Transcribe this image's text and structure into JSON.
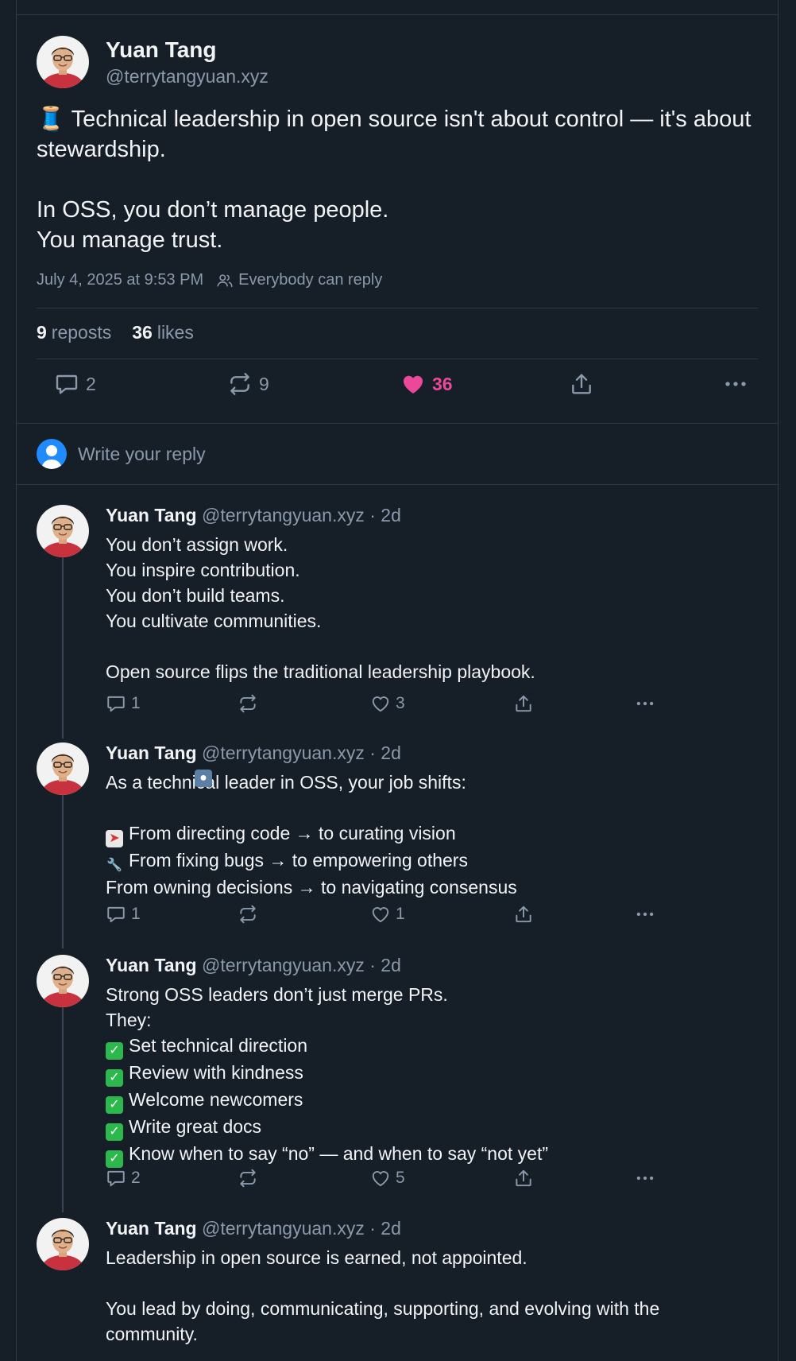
{
  "main_post": {
    "author_name": "Yuan Tang",
    "author_handle": "@terrytangyuan.xyz",
    "text_line1": "🧵 Technical leadership in open source isn't about control — it's about stewardship.",
    "text_line2": "In OSS, you don’t manage people.",
    "text_line3": "You manage trust.",
    "timestamp": "July 4, 2025 at 9:53 PM",
    "reply_setting": "Everybody can reply",
    "stats": {
      "reposts_count": "9",
      "reposts_label": "reposts",
      "likes_count": "36",
      "likes_label": "likes"
    },
    "actions": {
      "reply_count": "2",
      "repost_count": "9",
      "like_count": "36"
    }
  },
  "composer": {
    "placeholder": "Write your reply"
  },
  "replies": [
    {
      "name": "Yuan Tang",
      "handle": "@terrytangyuan.xyz · 2d",
      "lines": [
        "You don’t assign work.",
        "You inspire contribution.",
        "You don’t build teams.",
        "You cultivate communities.",
        "",
        "Open source flips the traditional leadership playbook."
      ],
      "reply_count": "1",
      "repost_count": "",
      "like_count": "3"
    },
    {
      "name": "Yuan Tang",
      "handle": "@terrytangyuan.xyz · 2d",
      "lines": [
        "As a technical leader in OSS, your job shifts:",
        "",
        "From directing code → to curating vision",
        "From fixing bugs → to empowering others",
        "From owning decisions → to navigating consensus"
      ],
      "reply_count": "1",
      "repost_count": "",
      "like_count": "1"
    },
    {
      "name": "Yuan Tang",
      "handle": "@terrytangyuan.xyz · 2d",
      "lines": [
        "Strong OSS leaders don’t just merge PRs.",
        "They:",
        "Set technical direction",
        "Review with kindness",
        "Welcome newcomers",
        "Write great docs",
        "Know when to say “no” — and when to say “not yet”"
      ],
      "reply_count": "2",
      "repost_count": "",
      "like_count": "5"
    },
    {
      "name": "Yuan Tang",
      "handle": "@terrytangyuan.xyz · 2d",
      "lines": [
        "Leadership in open source is earned, not appointed.",
        "",
        "You lead by doing, communicating, supporting, and evolving with the",
        "community."
      ]
    }
  ],
  "icons": {
    "reply": "speech-bubble-icon",
    "repost": "repost-arrows-icon",
    "like": "heart-icon",
    "share": "share-upload-icon",
    "more": "more-dots-icon",
    "people": "people-icon",
    "thread": "spool-thread-emoji",
    "check": "check-mark-emoji"
  },
  "colors": {
    "background": "#161e27",
    "text": "#f1f3f5",
    "muted": "#8a99ab",
    "border": "#2e3a48",
    "like": "#ec4899",
    "brand": "#208bfe"
  }
}
